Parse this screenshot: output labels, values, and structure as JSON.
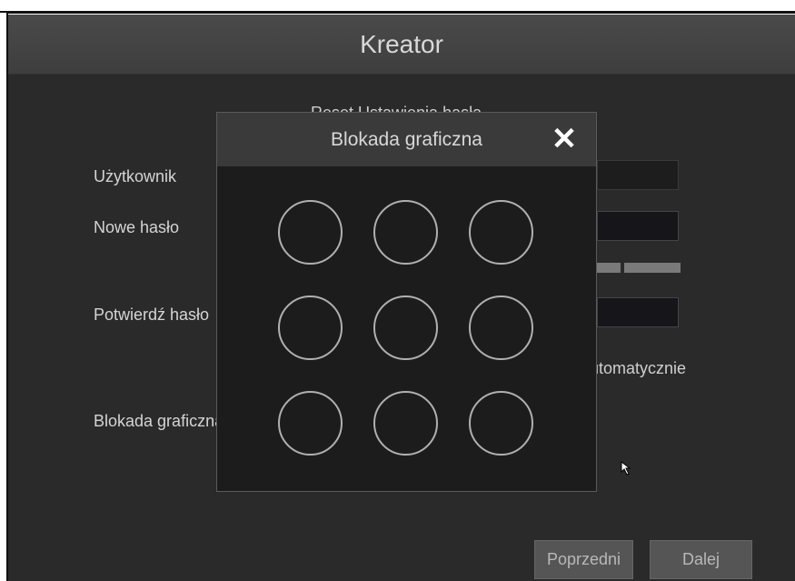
{
  "window": {
    "title": "Kreator"
  },
  "form": {
    "subtitle": "Reset Ustawienia hasła",
    "user_label": "Użytkownik",
    "new_password_label": "Nowe hasło",
    "confirm_password_label": "Potwierdź hasło",
    "pattern_label": "Blokada graficzna",
    "auto_text": "Automatycznie"
  },
  "dialog": {
    "title": "Blokada graficzna",
    "close_glyph": "✕",
    "dots": [
      "1",
      "2",
      "3",
      "4",
      "5",
      "6",
      "7",
      "8",
      "9"
    ]
  },
  "footer": {
    "prev_label": "Poprzedni",
    "next_label": "Dalej"
  },
  "colors": {
    "window_bg": "#2a2a2a",
    "titlebar_bg": "#444444",
    "dialog_bg": "#1c1c1c",
    "dot_stroke": "#b0b0b0"
  }
}
